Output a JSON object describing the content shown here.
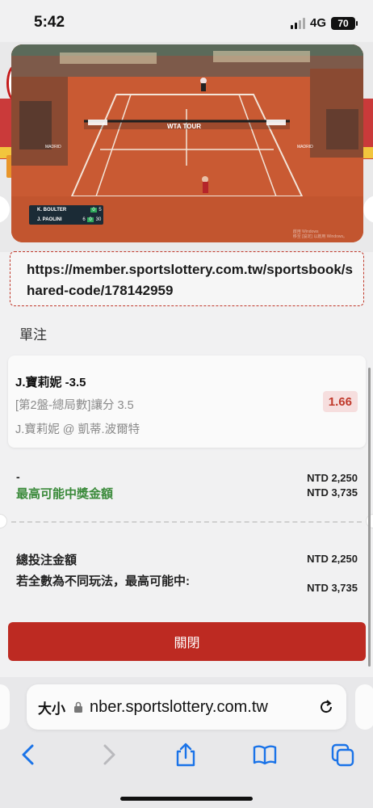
{
  "status_bar": {
    "time": "5:42",
    "network": "4G",
    "battery": "70"
  },
  "video": {
    "player1": "K. BOULTER",
    "player2": "J. PAOLINI",
    "p1_sets": "0",
    "p1_games": "5",
    "p2_sets": "6",
    "p2_games": "0",
    "p2_point": "30",
    "watermark_line1": "啟用 Windows",
    "watermark_line2": "移至 [設定] 以啟用 Windows。"
  },
  "share": {
    "url": "https://member.sportslottery.com.tw/sportsbook/shared-code/178142959"
  },
  "section_title": "單注",
  "bet": {
    "selection": "J.寶莉妮 -3.5",
    "market": "[第2盤-總局數]讓分 3.5",
    "matchup": "J.寶莉妮 @ 凱蒂.波爾特",
    "odds": "1.66"
  },
  "summary": {
    "label_dash": "-",
    "label_max_win": "最高可能中獎金額",
    "stake_value": "NTD 2,250",
    "max_win_value": "NTD 3,735"
  },
  "totals": {
    "total_stake_label": "總投注金額",
    "total_stake_value": "NTD 2,250",
    "max_all_label": "若全數為不同玩法，最高可能中:",
    "max_all_value": "NTD 3,735"
  },
  "close_button": "關閉",
  "browser": {
    "text_size": "大小",
    "domain": "nber.sportslottery.com.tw"
  },
  "icons": {
    "back": "chevron-left-icon",
    "forward": "chevron-right-icon",
    "share": "share-icon",
    "bookmarks": "book-icon",
    "tabs": "tabs-icon"
  },
  "colors": {
    "accent_red": "#bd2a22",
    "win_green": "#3a8a3a",
    "safari_blue": "#1a73e8"
  }
}
